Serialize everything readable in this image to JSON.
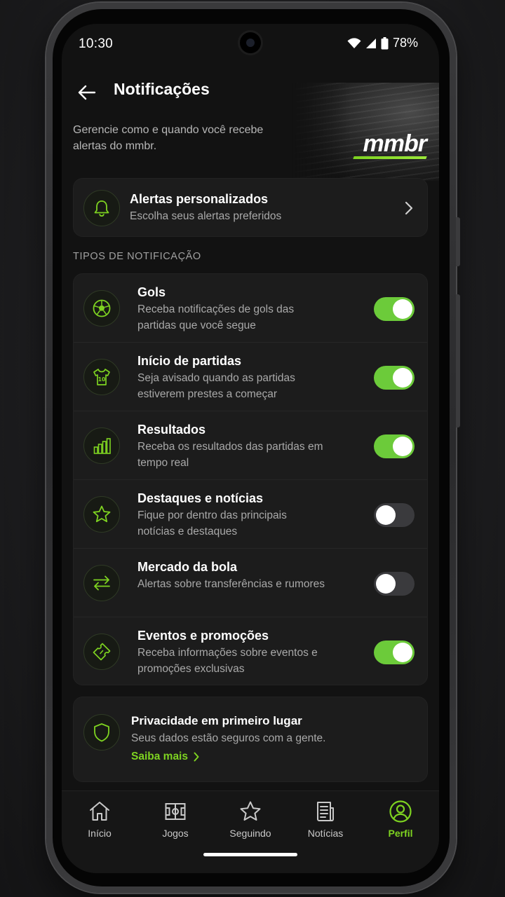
{
  "status_bar": {
    "time": "10:30",
    "battery": "78%"
  },
  "header": {
    "title": "Notificações",
    "subtitle": "Gerencie como e quando você recebe alertas do mmbr.",
    "logo": "mmbr"
  },
  "custom_alerts": {
    "title": "Alertas personalizados",
    "desc": "Escolha seus alertas preferidos",
    "icon": "bell-icon"
  },
  "section_label": "TIPOS DE NOTIFICAÇÃO",
  "notification_types": [
    {
      "title": "Gols",
      "desc": "Receba notificações de gols das partidas que você segue",
      "icon": "soccer-ball-icon",
      "enabled": true
    },
    {
      "title": "Início de partidas",
      "desc": "Seja avisado quando as partidas estiverem prestes a começar",
      "icon": "jersey-icon",
      "enabled": true
    },
    {
      "title": "Resultados",
      "desc": "Receba os resultados das partidas em tempo real",
      "icon": "bar-chart-icon",
      "enabled": true
    },
    {
      "title": "Destaques e notícias",
      "desc": "Fique por dentro das principais notícias e destaques",
      "icon": "star-icon",
      "enabled": false
    },
    {
      "title": "Mercado da bola",
      "desc": "Alertas sobre transferências e rumores",
      "icon": "transfer-arrows-icon",
      "enabled": false
    },
    {
      "title": "Eventos e promoções",
      "desc": "Receba informações sobre eventos e promoções exclusivas",
      "icon": "ticket-icon",
      "enabled": true
    }
  ],
  "privacy": {
    "title": "Privacidade em primeiro lugar",
    "desc": "Seus dados estão seguros com a gente.",
    "link": "Saiba mais",
    "icon": "shield-icon"
  },
  "bottom_nav": [
    {
      "label": "Início",
      "icon": "home-icon",
      "active": false
    },
    {
      "label": "Jogos",
      "icon": "field-icon",
      "active": false
    },
    {
      "label": "Seguindo",
      "icon": "star-icon",
      "active": false
    },
    {
      "label": "Notícias",
      "icon": "newspaper-icon",
      "active": false
    },
    {
      "label": "Perfil",
      "icon": "profile-icon",
      "active": true
    }
  ],
  "colors": {
    "accent": "#7ed321",
    "toggle_on": "#6ccb3a",
    "background": "#121212",
    "card": "#1c1c1c"
  }
}
